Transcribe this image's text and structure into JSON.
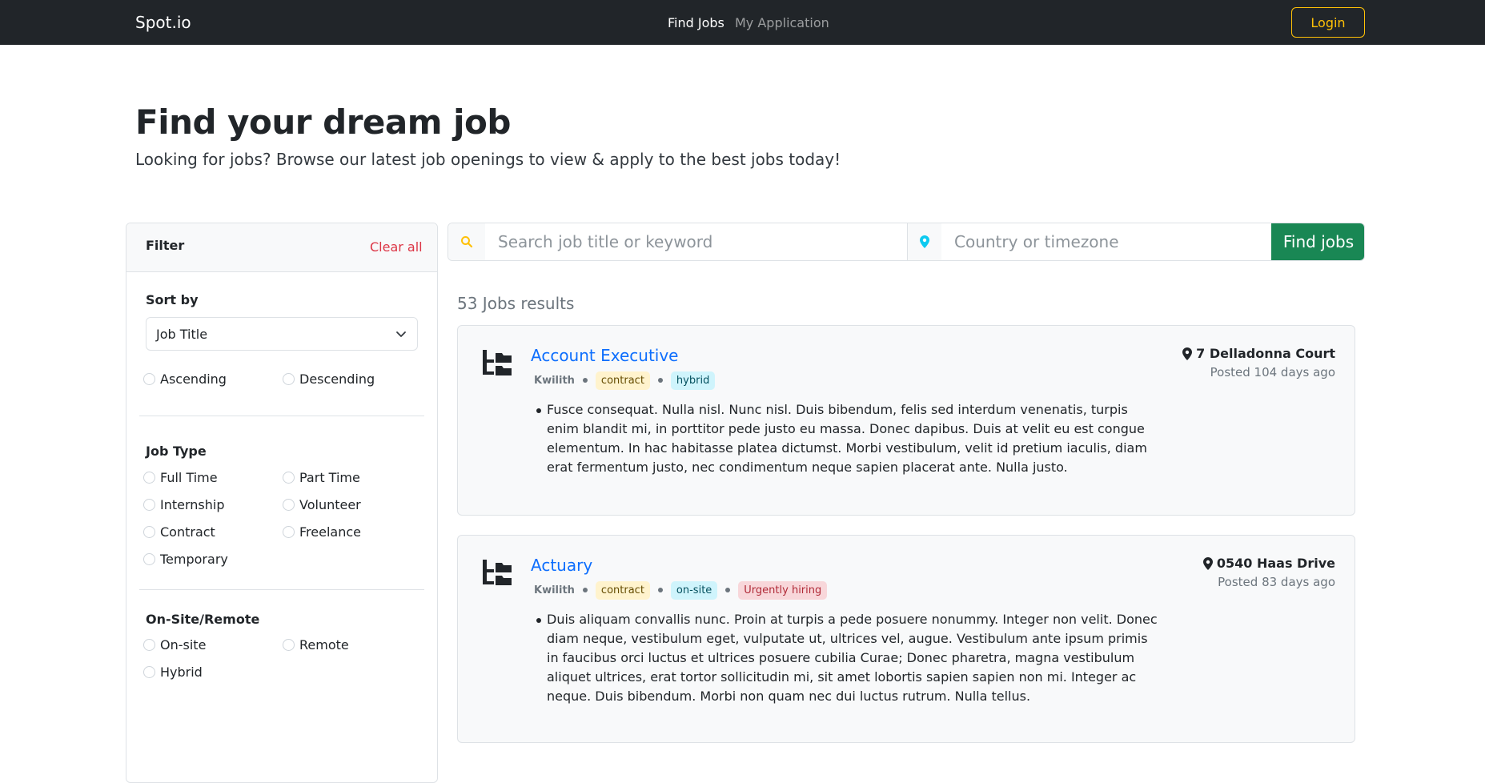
{
  "nav": {
    "brand": "Spot.io",
    "links": [
      "Find Jobs",
      "My Application"
    ],
    "login_label": "Login"
  },
  "hero": {
    "title": "Find your dream job",
    "subtitle": "Looking for jobs? Browse our latest job openings to view & apply to the best jobs today!"
  },
  "filter": {
    "title": "Filter",
    "clear_label": "Clear all",
    "sort_title": "Sort by",
    "sort_value": "Job Title",
    "order_options": [
      "Ascending",
      "Descending"
    ],
    "job_type_title": "Job Type",
    "job_types": [
      "Full Time",
      "Part Time",
      "Internship",
      "Volunteer",
      "Contract",
      "Freelance",
      "Temporary"
    ],
    "onsite_title": "On-Site/Remote",
    "onsite_options": [
      "On-site",
      "Remote",
      "Hybrid"
    ]
  },
  "search": {
    "keyword_placeholder": "Search job title or keyword",
    "location_placeholder": "Country or timezone",
    "button_label": "Find jobs",
    "search_icon": "search-icon",
    "location_icon": "map-pin-icon"
  },
  "results": {
    "count_text": "53 Jobs results",
    "jobs": [
      {
        "title": "Account Executive",
        "company": "Kwilith",
        "tags": [
          "contract",
          "hybrid"
        ],
        "description": "Fusce consequat. Nulla nisl. Nunc nisl. Duis bibendum, felis sed interdum venenatis, turpis enim blandit mi, in porttitor pede justo eu massa. Donec dapibus. Duis at velit eu est congue elementum. In hac habitasse platea dictumst. Morbi vestibulum, velit id pretium iaculis, diam erat fermentum justo, nec condimentum neque sapien placerat ante. Nulla justo.",
        "location": "7 Delladonna Court",
        "posted": "Posted 104 days ago"
      },
      {
        "title": "Actuary",
        "company": "Kwilith",
        "tags": [
          "contract",
          "on-site",
          "Urgently hiring"
        ],
        "description": "Duis aliquam convallis nunc. Proin at turpis a pede posuere nonummy. Integer non velit. Donec diam neque, vestibulum eget, vulputate ut, ultrices vel, augue. Vestibulum ante ipsum primis in faucibus orci luctus et ultrices posuere cubilia Curae; Donec pharetra, magna vestibulum aliquet ultrices, erat tortor sollicitudin mi, sit amet lobortis sapien sapien non mi. Integer ac neque. Duis bibendum. Morbi non quam nec dui luctus rutrum. Nulla tellus.",
        "location": "0540 Haas Drive",
        "posted": "Posted 83 days ago"
      }
    ]
  },
  "colors": {
    "navbar": "#212529",
    "login_accent": "#ffc107",
    "find_button": "#198754",
    "link_blue": "#0d6efd",
    "clear_red": "#dc3545",
    "search_icon": "#ffc107",
    "location_icon": "#0dcaf0"
  }
}
